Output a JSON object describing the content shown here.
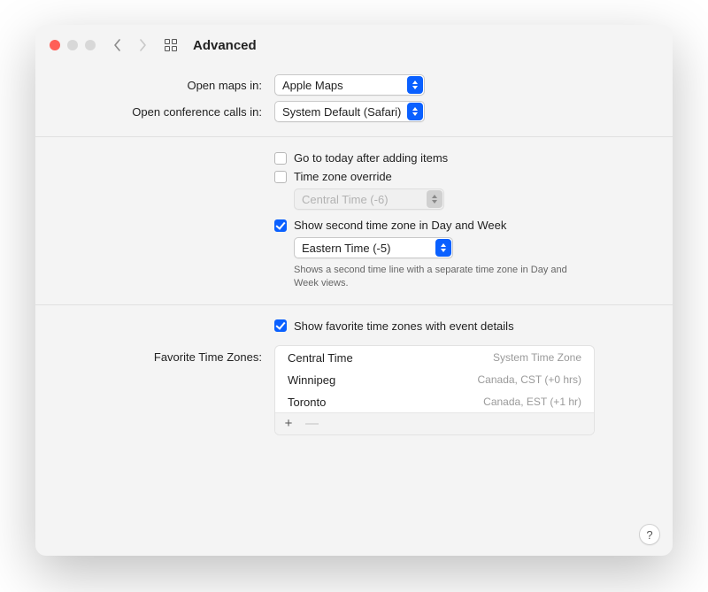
{
  "window": {
    "title": "Advanced"
  },
  "form": {
    "maps_label": "Open maps in:",
    "maps_value": "Apple Maps",
    "conf_label": "Open conference calls in:",
    "conf_value": "System Default (Safari)"
  },
  "options": {
    "goto_today": {
      "label": "Go to today after adding items",
      "checked": false
    },
    "tz_override": {
      "label": "Time zone override",
      "checked": false,
      "value": "Central Time (-6)"
    },
    "second_tz": {
      "label": "Show second time zone in Day and Week",
      "checked": true,
      "value": "Eastern Time (-5)",
      "help": "Shows a second time line with a separate time zone in Day and Week views."
    }
  },
  "favorites": {
    "show": {
      "label": "Show favorite time zones with event details",
      "checked": true
    },
    "label": "Favorite Time Zones:",
    "rows": [
      {
        "name": "Central Time",
        "detail": "System Time Zone"
      },
      {
        "name": "Winnipeg",
        "detail": "Canada, CST (+0 hrs)"
      },
      {
        "name": "Toronto",
        "detail": "Canada, EST (+1 hr)"
      }
    ],
    "add": "+",
    "remove": "—"
  },
  "help": "?"
}
